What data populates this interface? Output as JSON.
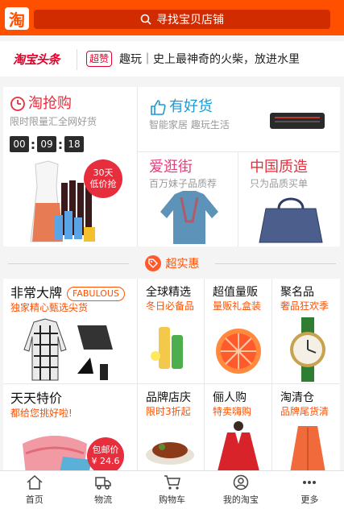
{
  "header": {
    "logo_text": "淘",
    "search_placeholder": "寻找宝贝店铺"
  },
  "headline": {
    "brand": "淘宝头条",
    "tag": "超赞",
    "text": "趣玩｜史上最神奇的火柴，放进水里"
  },
  "promo": {
    "flash": {
      "title": "淘抢购",
      "subtitle": "限时限量汇全网好货",
      "countdown": [
        "00",
        "09",
        "18"
      ],
      "badge_line1": "30天",
      "badge_line2": "低价抢"
    },
    "goods": {
      "title": "有好货",
      "subtitle": "智能家居 趣玩生活"
    },
    "stroll": {
      "title": "爱逛街",
      "subtitle": "百万妹子品质荐"
    },
    "quality": {
      "title": "中国质造",
      "subtitle": "只为品质买单"
    }
  },
  "section": {
    "title": "超实惠"
  },
  "products": [
    {
      "name": "非常大牌",
      "desc": "独家精心甄选尖货",
      "badge": "FABULOUS"
    },
    {
      "name": "全球精选",
      "desc": "冬日必备品"
    },
    {
      "name": "超值量贩",
      "desc": "量贩礼盒装"
    },
    {
      "name": "聚名品",
      "desc": "奢品狂欢季"
    },
    {
      "name": "天天特价",
      "desc": "都给您挑好啦!",
      "tag_line1": "包邮价",
      "tag_line2": "¥ 24.6"
    },
    {
      "name": "品牌店庆",
      "desc": "限时3折起"
    },
    {
      "name": "俪人购",
      "desc": "特卖嗨购"
    },
    {
      "name": "淘清仓",
      "desc": "品牌尾货清"
    }
  ],
  "tabs": [
    {
      "label": "首页",
      "icon": "home-icon"
    },
    {
      "label": "物流",
      "icon": "truck-icon"
    },
    {
      "label": "购物车",
      "icon": "cart-icon"
    },
    {
      "label": "我的淘宝",
      "icon": "user-icon"
    },
    {
      "label": "更多",
      "icon": "more-icon"
    }
  ],
  "colors": {
    "brand": "#ff5000",
    "red": "#e4002b",
    "blue": "#1a9ad6",
    "pink": "#e4407c"
  }
}
